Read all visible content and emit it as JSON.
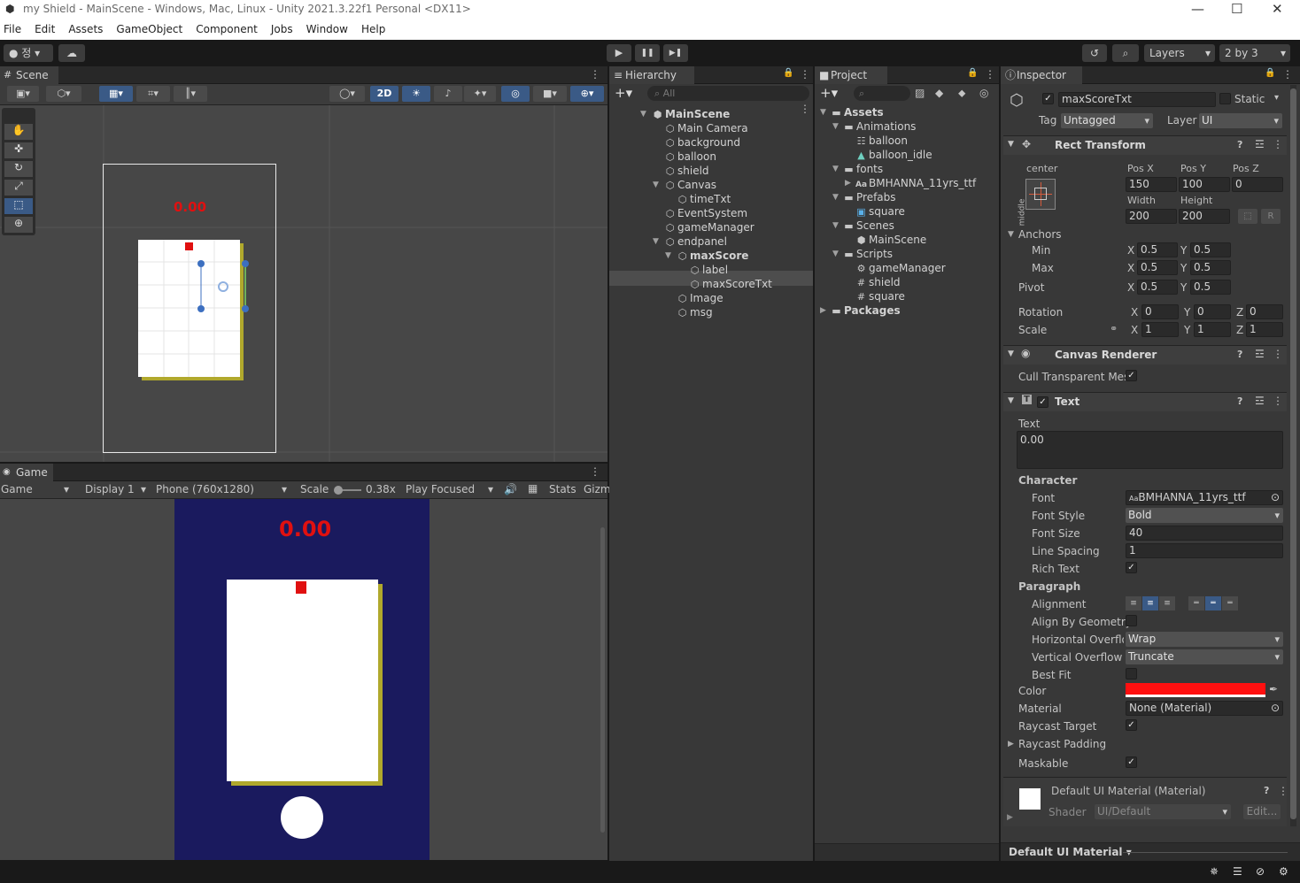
{
  "window": {
    "title": "my Shield - MainScene - Windows, Mac, Linux - Unity 2021.3.22f1 Personal <DX11>",
    "minimize": "—",
    "maximize": "☐",
    "close": "✕"
  },
  "menu": [
    "File",
    "Edit",
    "Assets",
    "GameObject",
    "Component",
    "Jobs",
    "Window",
    "Help"
  ],
  "toolbar": {
    "account": "● 정 ▾",
    "layers": "Layers",
    "layout": "2 by 3",
    "play": "▶",
    "pause": "❚❚",
    "step": "▶❚"
  },
  "scene": {
    "tab": "Scene",
    "btn_2d": "2D",
    "score_label": "0.00",
    "colors": {
      "score": "#e01010",
      "shadow": "#b0a82c"
    }
  },
  "game": {
    "tab": "Game",
    "mode": "Game",
    "display": "Display 1",
    "resolution": "Phone (760x1280)",
    "scale_label": "Scale",
    "scale_value": "0.38x",
    "play_mode": "Play Focused",
    "stats": "Stats",
    "gizmos": "Gizm",
    "score_label": "0.00",
    "colors": {
      "background": "#1a1a5e",
      "score": "#e01010",
      "card_shadow": "#b0a82c"
    }
  },
  "hierarchy": {
    "tab": "Hierarchy",
    "search_placeholder": "All",
    "items": [
      {
        "label": "MainScene",
        "depth": 0
      },
      {
        "label": "Main Camera",
        "depth": 1
      },
      {
        "label": "background",
        "depth": 1
      },
      {
        "label": "balloon",
        "depth": 1
      },
      {
        "label": "shield",
        "depth": 1
      },
      {
        "label": "Canvas",
        "depth": 1
      },
      {
        "label": "timeTxt",
        "depth": 2
      },
      {
        "label": "EventSystem",
        "depth": 1
      },
      {
        "label": "gameManager",
        "depth": 1
      },
      {
        "label": "endpanel",
        "depth": 1
      },
      {
        "label": "maxScore",
        "depth": 2
      },
      {
        "label": "label",
        "depth": 3
      },
      {
        "label": "maxScoreTxt",
        "depth": 3
      },
      {
        "label": "Image",
        "depth": 2
      },
      {
        "label": "msg",
        "depth": 2
      }
    ]
  },
  "project": {
    "tab": "Project",
    "items": [
      {
        "label": "Assets",
        "depth": 0
      },
      {
        "label": "Animations",
        "depth": 1
      },
      {
        "label": "balloon",
        "depth": 2
      },
      {
        "label": "balloon_idle",
        "depth": 2
      },
      {
        "label": "fonts",
        "depth": 1
      },
      {
        "label": "BMHANNA_11yrs_ttf",
        "depth": 2
      },
      {
        "label": "Prefabs",
        "depth": 1
      },
      {
        "label": "square",
        "depth": 2
      },
      {
        "label": "Scenes",
        "depth": 1
      },
      {
        "label": "MainScene",
        "depth": 2
      },
      {
        "label": "Scripts",
        "depth": 1
      },
      {
        "label": "gameManager",
        "depth": 2
      },
      {
        "label": "shield",
        "depth": 2
      },
      {
        "label": "square",
        "depth": 2
      },
      {
        "label": "Packages",
        "depth": 0
      }
    ]
  },
  "inspector": {
    "tab": "Inspector",
    "object_name": "maxScoreTxt",
    "static_label": "Static",
    "tag_label": "Tag",
    "tag_value": "Untagged",
    "layer_label": "Layer",
    "layer_value": "UI",
    "rect_transform": {
      "title": "Rect Transform",
      "anchor_h": "center",
      "anchor_v": "middle",
      "pos_x_label": "Pos X",
      "pos_x": "150",
      "pos_y_label": "Pos Y",
      "pos_y": "100",
      "pos_z_label": "Pos Z",
      "pos_z": "0",
      "width_label": "Width",
      "width": "200",
      "height_label": "Height",
      "height": "200",
      "anchors_label": "Anchors",
      "min_label": "Min",
      "min_x": "0.5",
      "min_y": "0.5",
      "max_label": "Max",
      "max_x": "0.5",
      "max_y": "0.5",
      "pivot_label": "Pivot",
      "pivot_x": "0.5",
      "pivot_y": "0.5",
      "rotation_label": "Rotation",
      "rot_x": "0",
      "rot_y": "0",
      "rot_z": "0",
      "scale_label": "Scale",
      "scale_x": "1",
      "scale_y": "1",
      "scale_z": "1",
      "x": "X",
      "y": "Y",
      "z": "Z",
      "r_button": "R"
    },
    "canvas_renderer": {
      "title": "Canvas Renderer",
      "cull_label": "Cull Transparent Mes"
    },
    "text": {
      "title": "Text",
      "text_label": "Text",
      "text_value": "0.00",
      "character_label": "Character",
      "font_label": "Font",
      "font_value": "BMHANNA_11yrs_ttf",
      "font_prefix": "Aa",
      "font_style_label": "Font Style",
      "font_style_value": "Bold",
      "font_size_label": "Font Size",
      "font_size_value": "40",
      "line_spacing_label": "Line Spacing",
      "line_spacing_value": "1",
      "rich_text_label": "Rich Text",
      "paragraph_label": "Paragraph",
      "alignment_label": "Alignment",
      "align_geometry_label": "Align By Geometry",
      "h_overflow_label": "Horizontal Overflo",
      "h_overflow_value": "Wrap",
      "v_overflow_label": "Vertical Overflow",
      "v_overflow_value": "Truncate",
      "best_fit_label": "Best Fit",
      "color_label": "Color",
      "color_value": "#ff1010",
      "material_label": "Material",
      "material_value": "None (Material)",
      "raycast_target_label": "Raycast Target",
      "raycast_padding_label": "Raycast Padding",
      "maskable_label": "Maskable"
    },
    "material": {
      "name": "Default UI Material (Material)",
      "shader_label": "Shader",
      "shader_value": "UI/Default",
      "edit_label": "Edit..."
    },
    "footer_label": "Default UI Material ▾"
  },
  "icons": {
    "check": "✓",
    "menu_dots": "⋮",
    "lock": "🔒",
    "help": "?",
    "settings": "≡"
  }
}
